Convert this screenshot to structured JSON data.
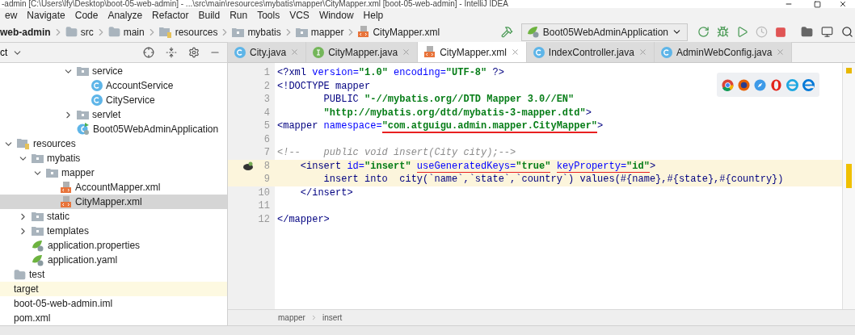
{
  "window": {
    "title": "-admin [C:\\Users\\lfy\\Desktop\\boot-05-web-admin] - ...\\src\\main\\resources\\mybatis\\mapper\\CityMapper.xml [boot-05-web-admin] - IntelliJ IDEA"
  },
  "menu": [
    "ew",
    "Navigate",
    "Code",
    "Analyze",
    "Refactor",
    "Build",
    "Run",
    "Tools",
    "VCS",
    "Window",
    "Help"
  ],
  "breadcrumb": [
    {
      "label": "web-admin",
      "kind": "module"
    },
    {
      "label": "src",
      "kind": "folder"
    },
    {
      "label": "main",
      "kind": "folder"
    },
    {
      "label": "resources",
      "kind": "resources"
    },
    {
      "label": "mybatis",
      "kind": "package"
    },
    {
      "label": "mapper",
      "kind": "package"
    },
    {
      "label": "CityMapper.xml",
      "kind": "xml"
    }
  ],
  "run_config": "Boot05WebAdminApplication",
  "project_panel": {
    "title": "ct"
  },
  "tabs": [
    {
      "label": "City.java",
      "kind": "class",
      "selected": false
    },
    {
      "label": "CityMapper.java",
      "kind": "interface",
      "selected": false
    },
    {
      "label": "CityMapper.xml",
      "kind": "xml",
      "selected": true
    },
    {
      "label": "IndexController.java",
      "kind": "class",
      "selected": false
    },
    {
      "label": "AdminWebConfig.java",
      "kind": "class",
      "selected": false
    }
  ],
  "tree": {
    "clipped_branch": [
      {
        "label": "service",
        "kind": "package",
        "expanded": true,
        "selected": false,
        "excluded": false,
        "children": [
          {
            "label": "AccountService",
            "kind": "class",
            "selected": false,
            "excluded": false
          },
          {
            "label": "CityService",
            "kind": "class",
            "selected": false,
            "excluded": false
          }
        ]
      },
      {
        "label": "servlet",
        "kind": "package",
        "expanded": false,
        "selected": false,
        "excluded": false
      },
      {
        "label": "Boot05WebAdminApplication",
        "kind": "spring-app",
        "selected": false,
        "excluded": false
      }
    ],
    "items": [
      {
        "label": "resources",
        "kind": "resources",
        "expanded": true,
        "selected": false,
        "excluded": false,
        "children": [
          {
            "label": "mybatis",
            "kind": "package",
            "expanded": true,
            "selected": false,
            "excluded": false,
            "children": [
              {
                "label": "mapper",
                "kind": "package",
                "expanded": true,
                "selected": false,
                "excluded": false,
                "children": [
                  {
                    "label": "AccountMapper.xml",
                    "kind": "xml",
                    "selected": false,
                    "excluded": false
                  },
                  {
                    "label": "CityMapper.xml",
                    "kind": "xml",
                    "selected": true,
                    "excluded": false
                  }
                ]
              }
            ]
          },
          {
            "label": "static",
            "kind": "package",
            "expanded": false,
            "selected": false,
            "excluded": false
          },
          {
            "label": "templates",
            "kind": "package",
            "expanded": false,
            "selected": false,
            "excluded": false
          },
          {
            "label": "application.properties",
            "kind": "spring-config",
            "selected": false,
            "excluded": false
          },
          {
            "label": "application.yaml",
            "kind": "spring-config",
            "selected": false,
            "excluded": false
          }
        ]
      }
    ],
    "roots": [
      {
        "label": "test",
        "kind": "folder",
        "selected": false,
        "excluded": false
      },
      {
        "label": "target",
        "kind": "plain",
        "selected": false,
        "excluded": true
      },
      {
        "label": "boot-05-web-admin.iml",
        "kind": "plain",
        "selected": false,
        "excluded": false
      },
      {
        "label": "pom.xml",
        "kind": "plain",
        "selected": false,
        "excluded": false
      }
    ]
  },
  "editor": {
    "lines": [
      {
        "number": "1",
        "highlighted": false,
        "gutter_icon": false,
        "tokens": [
          {
            "kind": "tag",
            "text": "<?xml "
          },
          {
            "kind": "attr",
            "text": "version="
          },
          {
            "kind": "value",
            "text": "\"1.0\" "
          },
          {
            "kind": "attr",
            "text": "encoding="
          },
          {
            "kind": "value",
            "text": "\"UTF-8\" "
          },
          {
            "kind": "tag",
            "text": "?>"
          }
        ]
      },
      {
        "number": "2",
        "highlighted": false,
        "gutter_icon": false,
        "tokens": [
          {
            "kind": "tag",
            "text": "<!DOCTYPE mapper"
          }
        ]
      },
      {
        "number": "3",
        "highlighted": false,
        "gutter_icon": false,
        "tokens": [
          {
            "kind": "tag",
            "text": "        PUBLIC "
          },
          {
            "kind": "value",
            "text": "\"-//mybatis.org//DTD Mapper 3.0//EN\""
          }
        ]
      },
      {
        "number": "4",
        "highlighted": false,
        "gutter_icon": false,
        "tokens": [
          {
            "kind": "value",
            "text": "        \"http://mybatis.org/dtd/mybatis-3-mapper.dtd\""
          },
          {
            "kind": "tag",
            "text": ">"
          }
        ]
      },
      {
        "number": "5",
        "highlighted": false,
        "gutter_icon": false,
        "tokens": [
          {
            "kind": "tag",
            "text": "<mapper "
          },
          {
            "kind": "attr",
            "text": "namespace="
          },
          {
            "kind": "value",
            "text": "\"com.atguigu.admin.mapper.CityMapper\"",
            "underlined": true
          },
          {
            "kind": "tag",
            "text": ">"
          }
        ]
      },
      {
        "number": "6",
        "highlighted": false,
        "gutter_icon": false
      },
      {
        "number": "7",
        "highlighted": false,
        "gutter_icon": false,
        "tokens": [
          {
            "kind": "comment",
            "text": "<!--    public void insert(City city);-->"
          }
        ]
      },
      {
        "number": "8",
        "highlighted": true,
        "gutter_icon": true,
        "tokens": [
          {
            "kind": "tag",
            "text": "    <insert "
          },
          {
            "kind": "attr",
            "text": "id="
          },
          {
            "kind": "value",
            "text": "\"insert\" "
          },
          {
            "kind": "attr",
            "text": "useGeneratedKeys=",
            "underlined": true
          },
          {
            "kind": "value",
            "text": "\"true\"",
            "underlined": true
          },
          {
            "kind": "attr",
            "text": " keyProperty=",
            "underlined": true
          },
          {
            "kind": "value",
            "text": "\"id\"",
            "underlined": true
          },
          {
            "kind": "tag",
            "text": ">"
          }
        ]
      },
      {
        "number": "9",
        "highlighted": true,
        "gutter_icon": false,
        "tokens": [
          {
            "kind": "tag",
            "text": "        insert into  city(`name`,`state`,`country`) values(#{name},#{state},#{country})"
          }
        ]
      },
      {
        "number": "10",
        "highlighted": false,
        "gutter_icon": false,
        "tokens": [
          {
            "kind": "tag",
            "text": "    </insert>"
          }
        ]
      },
      {
        "number": "11",
        "highlighted": false,
        "gutter_icon": false
      },
      {
        "number": "12",
        "highlighted": false,
        "gutter_icon": false,
        "tokens": [
          {
            "kind": "tag",
            "text": "</mapper>"
          }
        ]
      }
    ],
    "path": [
      "mapper",
      "insert"
    ]
  }
}
